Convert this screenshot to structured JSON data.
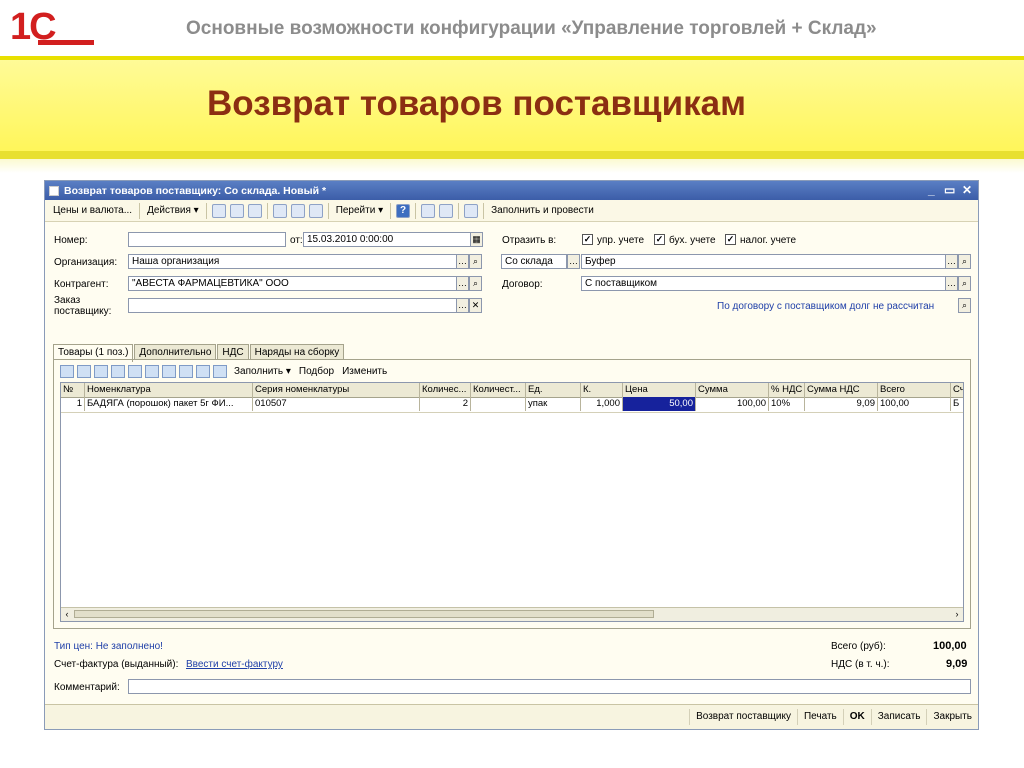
{
  "slide": {
    "logo": "1С",
    "subtitle": "Основные возможности конфигурации «Управление торговлей + Склад»",
    "title": "Возврат товаров поставщикам"
  },
  "window": {
    "title": "Возврат товаров поставщику: Со склада. Новый *",
    "controls": [
      "_",
      "▭",
      "✕"
    ]
  },
  "toolbar": {
    "prices": "Цены и валюта...",
    "actions": "Действия ▾",
    "goto": "Перейти ▾",
    "help": "?",
    "fill_post": "Заполнить и провести"
  },
  "form": {
    "number_label": "Номер:",
    "number_value": "",
    "from_label": "от:",
    "date_value": "15.03.2010  0:00:00",
    "org_label": "Организация:",
    "org_value": "Наша организация",
    "contractor_label": "Контрагент:",
    "contractor_value": "\"АВЕСТА ФАРМАЦЕВТИКА\" ООО",
    "order_label": "Заказ поставщику:",
    "order_value": "",
    "reflect_label": "Отразить в:",
    "reflect_mgmt": "упр. учете",
    "reflect_acc": "бух. учете",
    "reflect_tax": "налог. учете",
    "warehouse_type": "Со склада",
    "warehouse_value": "Буфер",
    "contract_label": "Договор:",
    "contract_value": "С поставщиком",
    "debt_note": "По договору с поставщиком долг не рассчитан"
  },
  "tabs": [
    "Товары (1 поз.)",
    "Дополнительно",
    "НДС",
    "Наряды на сборку"
  ],
  "grid_toolbar": {
    "fill": "Заполнить ▾",
    "select": "Подбор",
    "change": "Изменить"
  },
  "grid": {
    "columns": [
      "№",
      "Номенклатура",
      "Серия номенклатуры",
      "Количес...",
      "Количест...",
      "Ед.",
      "К.",
      "Цена",
      "Сумма",
      "% НДС",
      "Сумма НДС",
      "Всего",
      "Сч"
    ],
    "rows": [
      [
        "1",
        "БАДЯГА (порошок) пакет 5г ФИ...",
        "010507",
        "2",
        "",
        "упак",
        "1,000",
        "50,00",
        "100,00",
        "10%",
        "9,09",
        "100,00",
        "Б"
      ]
    ]
  },
  "footer": {
    "price_type": "Тип цен: Не заполнено!",
    "invoice_label": "Счет-фактура (выданный):",
    "invoice_link": "Ввести счет-фактуру",
    "total_label": "Всего (руб):",
    "total_value": "100,00",
    "vat_label": "НДС (в т. ч.):",
    "vat_value": "9,09",
    "comment_label": "Комментарий:",
    "comment_value": ""
  },
  "bottom_buttons": {
    "return": "Возврат поставщику",
    "print": "Печать",
    "ok": "OK",
    "save": "Записать",
    "close": "Закрыть"
  }
}
